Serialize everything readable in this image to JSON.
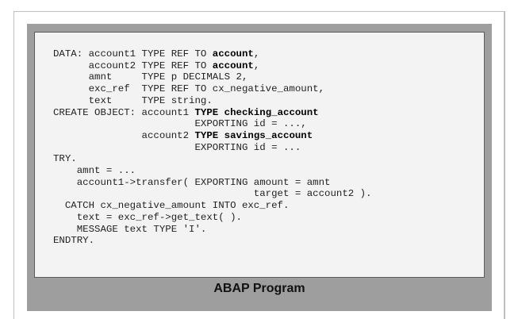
{
  "figure_caption": "ABAP Program",
  "code_lines": [
    [
      {
        "t": "DATA: account1 TYPE REF TO "
      },
      {
        "t": "account",
        "b": true
      },
      {
        "t": ","
      }
    ],
    [
      {
        "t": "      account2 TYPE REF TO "
      },
      {
        "t": "account",
        "b": true
      },
      {
        "t": ","
      }
    ],
    [
      {
        "t": "      amnt     TYPE p DECIMALS 2,"
      }
    ],
    [
      {
        "t": "      exc_ref  TYPE REF TO cx_negative_amount,"
      }
    ],
    [
      {
        "t": "      text     TYPE string."
      }
    ],
    [
      {
        "t": "CREATE OBJECT: account1 "
      },
      {
        "t": "TYPE checking_account",
        "b": true
      }
    ],
    [
      {
        "t": "                        EXPORTING id = ...,"
      }
    ],
    [
      {
        "t": "               account2 "
      },
      {
        "t": "TYPE savings_account",
        "b": true
      }
    ],
    [
      {
        "t": "                        EXPORTING id = ..."
      }
    ],
    [
      {
        "t": "TRY."
      }
    ],
    [
      {
        "t": "    amnt = ..."
      }
    ],
    [
      {
        "t": "    account1->transfer( EXPORTING amount = amnt"
      }
    ],
    [
      {
        "t": "                                  target = account2 )."
      }
    ],
    [
      {
        "t": "  CATCH cx_negative_amount INTO exc_ref."
      }
    ],
    [
      {
        "t": "    text = exc_ref->get_text( )."
      }
    ],
    [
      {
        "t": "    MESSAGE text TYPE 'I'."
      }
    ],
    [
      {
        "t": "ENDTRY."
      }
    ]
  ]
}
